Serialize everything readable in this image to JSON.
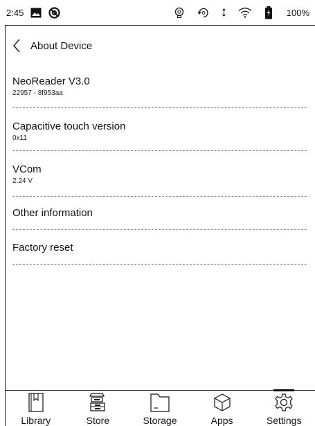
{
  "status_bar": {
    "time": "2:45",
    "battery_percent": "100%",
    "icons": [
      "gallery-icon",
      "sync-blocked-icon",
      "lightbulb-icon",
      "refresh-icon",
      "wifi-icon",
      "battery-icon"
    ]
  },
  "header": {
    "back_icon": "chevron-left-icon",
    "title": "About Device"
  },
  "items": [
    {
      "label": "NeoReader V3.0",
      "sub": "22957 - 8f953aa"
    },
    {
      "label": "Capacitive touch version",
      "sub": "0x11"
    },
    {
      "label": "VCom",
      "sub": "2.24 V"
    },
    {
      "label": "Other information"
    },
    {
      "label": "Factory reset"
    }
  ],
  "tabs": [
    {
      "label": "Library",
      "icon": "book-icon"
    },
    {
      "label": "Store",
      "icon": "store-icon"
    },
    {
      "label": "Storage",
      "icon": "folder-icon"
    },
    {
      "label": "Apps",
      "icon": "cube-icon"
    },
    {
      "label": "Settings",
      "icon": "gear-icon",
      "active": true
    }
  ]
}
